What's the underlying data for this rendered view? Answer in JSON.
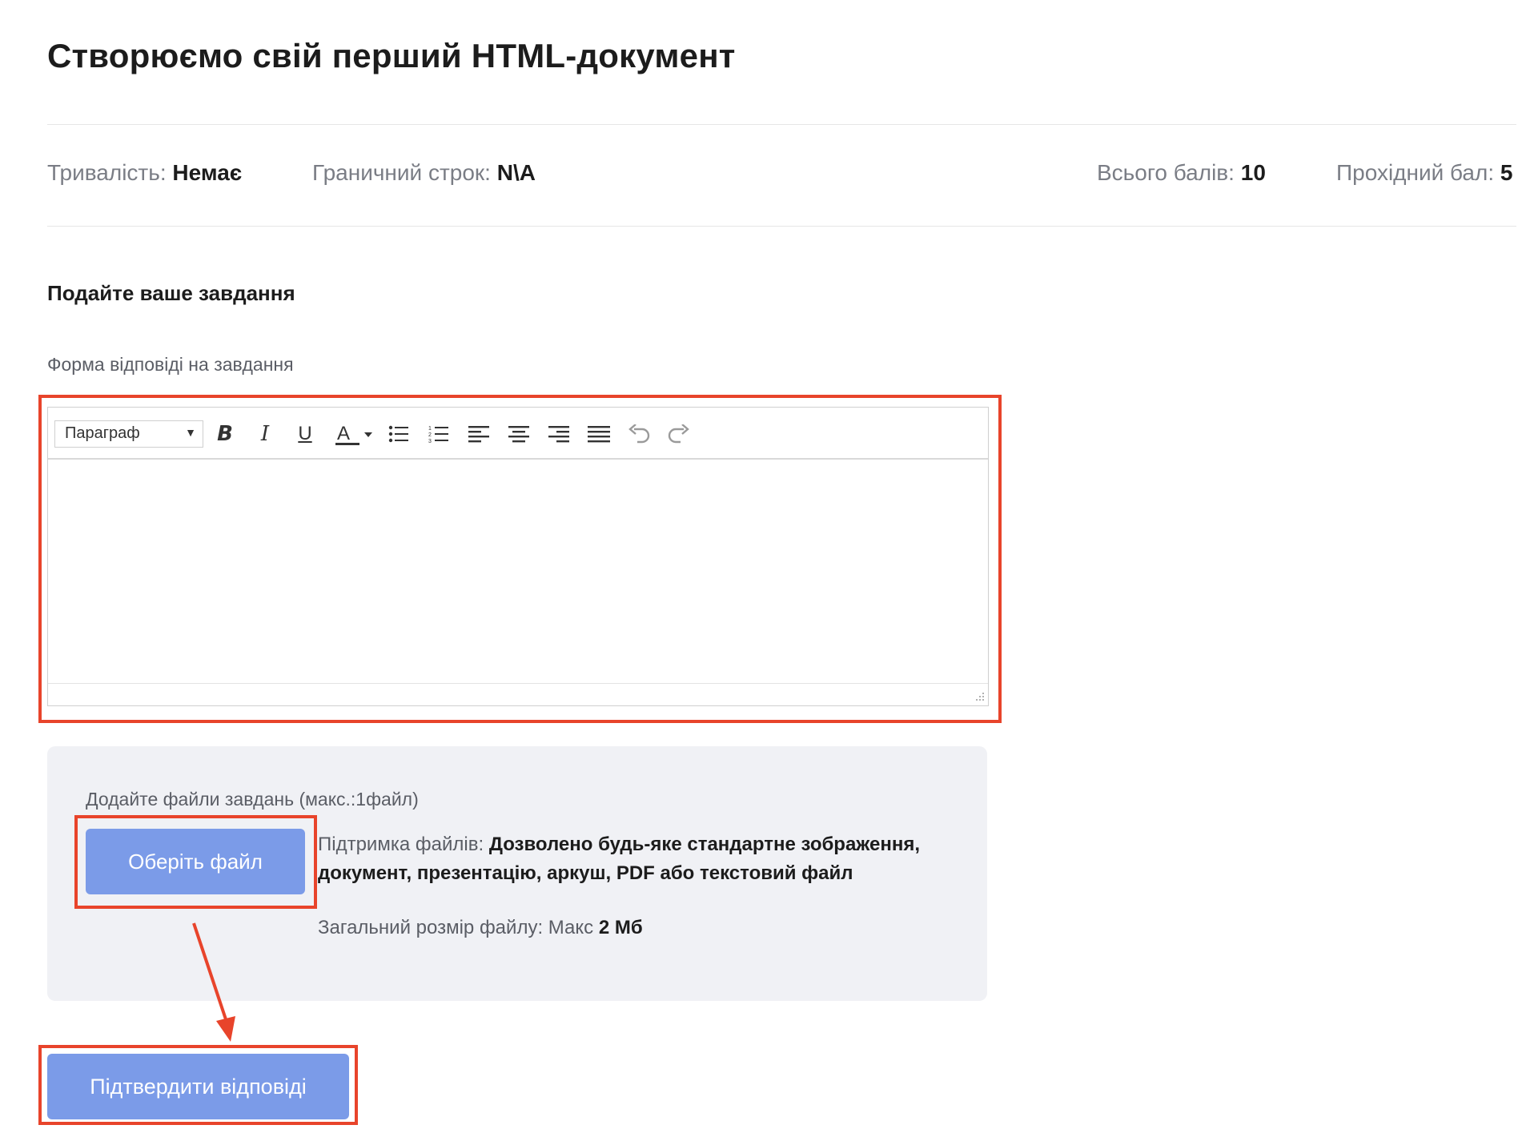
{
  "page": {
    "title": "Створюємо свій перший HTML-документ"
  },
  "meta": {
    "duration_label": "Тривалість:",
    "duration_value": "Немає",
    "deadline_label": "Граничний строк:",
    "deadline_value": "N\\A",
    "total_label": "Всього балів:",
    "total_value": "10",
    "passing_label": "Прохідний бал:",
    "passing_value": "5"
  },
  "submission": {
    "section_title": "Подайте ваше завдання",
    "form_label": "Форма відповіді на завдання"
  },
  "editor": {
    "format_select": "Параграф",
    "toolbar_icons": [
      "bold-icon",
      "italic-icon",
      "underline-icon",
      "text-color-icon",
      "bullet-list-icon",
      "numbered-list-icon",
      "align-left-icon",
      "align-center-icon",
      "align-right-icon",
      "justify-icon",
      "undo-icon",
      "redo-icon"
    ],
    "content": ""
  },
  "upload": {
    "label": "Додайте файли завдань (макс.:1файл)",
    "choose_button": "Оберіть файл",
    "support_label": "Підтримка файлів:",
    "support_value": "Дозволено будь-яке стандартне зображення, документ, презентацію, аркуш, PDF або текстовий файл",
    "size_label": "Загальний розмір файлу: Макс",
    "size_value": "2 Мб"
  },
  "actions": {
    "confirm_button": "Підтвердити відповіді"
  },
  "colors": {
    "button": "#7b9be8",
    "highlight": "#e8442b",
    "panel": "#f0f1f5"
  }
}
